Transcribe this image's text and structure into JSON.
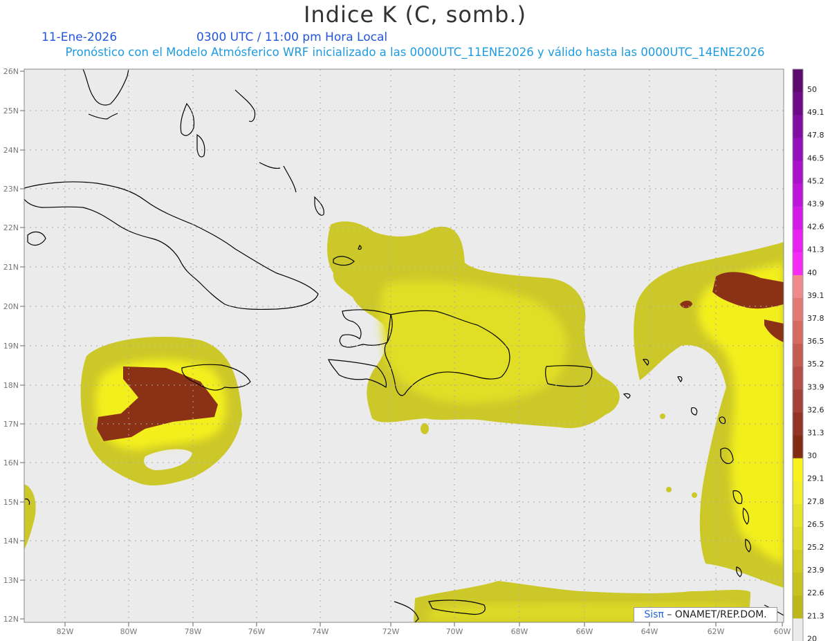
{
  "header": {
    "title": "Indice K (C, somb.)",
    "date": "11-Ene-2026",
    "time": "0300 UTC / 11:00 pm Hora Local",
    "forecast_line": "Pronóstico con el Modelo Atmósferico WRF inicializado a las 0000UTC_11ENE2026 y válido hasta las  0000UTC_14ENE2026"
  },
  "axes": {
    "lat_labels": [
      "26N",
      "25N",
      "24N",
      "23N",
      "22N",
      "21N",
      "20N",
      "19N",
      "18N",
      "17N",
      "16N",
      "15N",
      "14N",
      "13N",
      "12N"
    ],
    "lon_labels": [
      "82W",
      "80W",
      "78W",
      "76W",
      "74W",
      "72W",
      "70W",
      "68W",
      "66W",
      "64W",
      "62W",
      "60W"
    ]
  },
  "colorbar": {
    "ticks": [
      "50",
      "49.1",
      "47.8",
      "46.5",
      "45.2",
      "43.9",
      "42.6",
      "41.3",
      "40",
      "39.1",
      "37.8",
      "36.5",
      "35.2",
      "33.9",
      "32.6",
      "31.3",
      "30",
      "29.1",
      "27.8",
      "26.5",
      "25.2",
      "23.9",
      "22.6",
      "21.3",
      "20"
    ],
    "colors": [
      "#5c0a6e",
      "#6d0c88",
      "#800ea0",
      "#9410b8",
      "#a812c8",
      "#bd16d8",
      "#d21be6",
      "#e622f0",
      "#f52cf6",
      "#ef8a8a",
      "#e07a72",
      "#d46a62",
      "#c45c54",
      "#b44e46",
      "#a4423a",
      "#923428",
      "#822c14",
      "#f7f21c",
      "#f0ec2a",
      "#e6e22a",
      "#dcd826",
      "#d0cc22",
      "#c6c220",
      "#bcb81c",
      "#ebebeb"
    ]
  },
  "credit": {
    "sis": "Sisπ",
    "rest": " – ONAMET/REP.DOM."
  },
  "colors": {
    "map_bg": "#ebebeb",
    "coast": "#000000",
    "field_low": "#cdc829",
    "field_high": "#f5f21a",
    "field_max": "#8b3216"
  }
}
